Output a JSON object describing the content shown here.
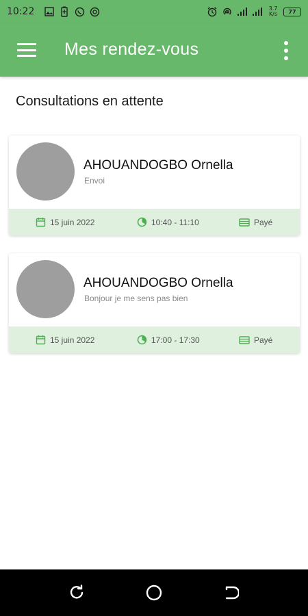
{
  "status_bar": {
    "time": "10:22",
    "network_speed_value": "3.7",
    "network_speed_unit": "K/s",
    "battery": "77"
  },
  "app_bar": {
    "title": "Mes rendez-vous"
  },
  "section": {
    "title": "Consultations en attente"
  },
  "appointments": [
    {
      "name": "AHOUANDOGBO Ornella",
      "message": "Envoi",
      "date": "15 juin 2022",
      "time": "10:40 - 11:10",
      "payment_status": "Payé"
    },
    {
      "name": "AHOUANDOGBO Ornella",
      "message": "Bonjour je me sens pas bien",
      "date": "15 juin 2022",
      "time": "17:00 - 17:30",
      "payment_status": "Payé"
    }
  ],
  "colors": {
    "primary": "#68b86c",
    "card_footer": "#dff0df",
    "icon_green": "#4caf50",
    "avatar_placeholder": "#9e9e9e"
  },
  "icons": {
    "menu": "menu-icon",
    "more": "more-vert-icon",
    "date": "calendar-icon",
    "time": "clock-icon",
    "payment": "payment-icon"
  }
}
